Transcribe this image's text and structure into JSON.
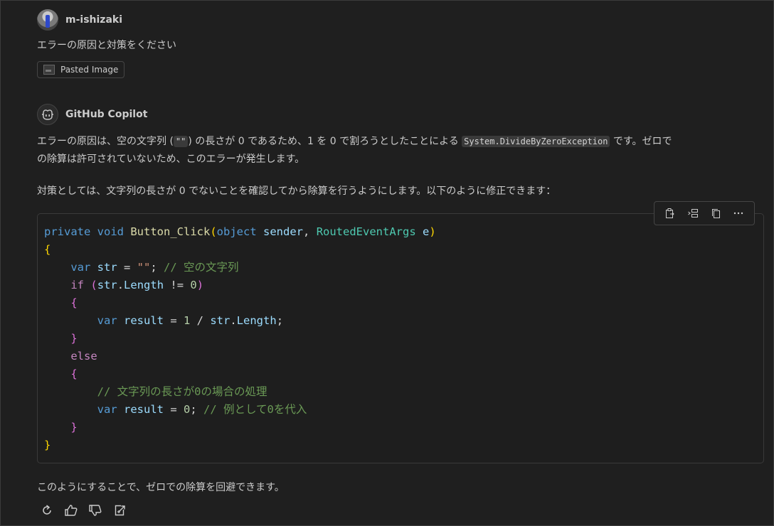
{
  "user_message": {
    "username": "m-ishizaki",
    "text": "エラーの原因と対策をください",
    "attachment_label": "Pasted Image"
  },
  "assistant": {
    "name": "GitHub Copilot",
    "p1_line1_a": "エラーの原因は、空の文字列 (",
    "p1_code1": "\"\"",
    "p1_line1_b": ") の長さが 0 であるため、1 を 0 で割ろうとしたことによる ",
    "p1_code2": "System.DivideByZeroException",
    "p1_line1_c": " です。ゼロで",
    "p1_line2": "の除算は許可されていないため、このエラーが発生します。",
    "p2": "対策としては、文字列の長さが 0 でないことを確認してから除算を行うようにします。以下のように修正できます：",
    "closing": "このようにすることで、ゼロでの除算を回避できます。"
  },
  "code": {
    "language": "csharp",
    "lines": [
      "private void Button_Click(object sender, RoutedEventArgs e)",
      "{",
      "    var str = \"\"; // 空の文字列",
      "    if (str.Length != 0)",
      "    {",
      "        var result = 1 / str.Length;",
      "    }",
      "    else",
      "    {",
      "        // 文字列の長さが0の場合の処理",
      "        var result = 0; // 例として0を代入",
      "    }",
      "}"
    ],
    "toolbar": [
      "apply-in-editor-icon",
      "insert-at-cursor-icon",
      "copy-icon",
      "more-icon"
    ]
  },
  "feedback_actions": [
    "retry-icon",
    "thumbs-up-icon",
    "thumbs-down-icon",
    "insert-into-new-file-icon"
  ]
}
